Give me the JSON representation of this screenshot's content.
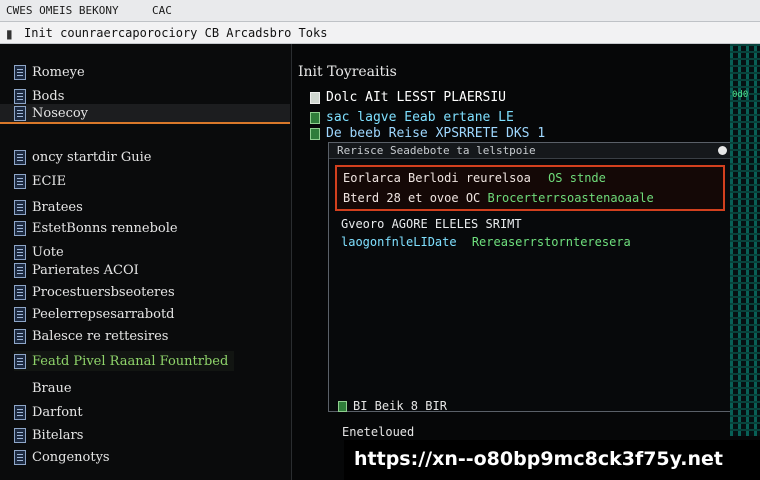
{
  "window": {
    "title_left": "CWES OMEIS BEKONY",
    "title_right": "CAC",
    "path_icon": "folder-icon",
    "path": "Init counraercaporociory CB Arcadsbro Toks"
  },
  "sidebar": {
    "items": [
      {
        "label": "Romeye"
      },
      {
        "label": "Bods"
      },
      {
        "label": "Nosecoy"
      },
      {
        "label": "oncy startdir Guie"
      },
      {
        "label": "ECIE"
      },
      {
        "label": "Bratees"
      },
      {
        "label": "EstetBonns rennebole"
      },
      {
        "label": "Uote"
      },
      {
        "label": "Parierates ACOI"
      },
      {
        "label": "Procestuersbseoteres"
      },
      {
        "label": "Peelerrepsesarrabotd"
      },
      {
        "label": "Balesce re rettesires"
      },
      {
        "label": "Featd Pivel Raanal Fountrbed"
      },
      {
        "label": "Braue"
      },
      {
        "label": "Darfont"
      },
      {
        "label": "Bitelars"
      },
      {
        "label": "Congenotys"
      }
    ]
  },
  "main": {
    "heading": "Init Toyreaitis",
    "rows": [
      {
        "label": "Dolc AIt LESST PLAERSIU"
      },
      {
        "label": "sac lagve Eeab ertane LE"
      },
      {
        "label": "De beeb Reise XPSRRETE DKS 1"
      }
    ],
    "console": {
      "header": "Rerisce Seadebote ta lelstpoie",
      "error_line1": "Eorlarca Berlodi reurelsoa",
      "error_line1_status": "OS stnde",
      "error_line2": "Bterd 28 et ovoe OC",
      "error_line2_status": "Brocerterrsoastenaoaale",
      "line3": "Gveoro AGORE ELELES SRIMT",
      "line4_prefix": "laogonfnleLIDate",
      "line4_status": "Rereaserrstornteresera"
    },
    "bottom_row": "BI Beik 8 BIR",
    "bottom_row2": "Eneteloued"
  },
  "right_strip": {
    "tag": "0d0"
  },
  "watermark_url": "https://xn--o80bp9mc8ck3f75y.net",
  "colors": {
    "accent_orange": "#d9782a",
    "error_red": "#d2401e",
    "text_green": "#6fe07e"
  }
}
